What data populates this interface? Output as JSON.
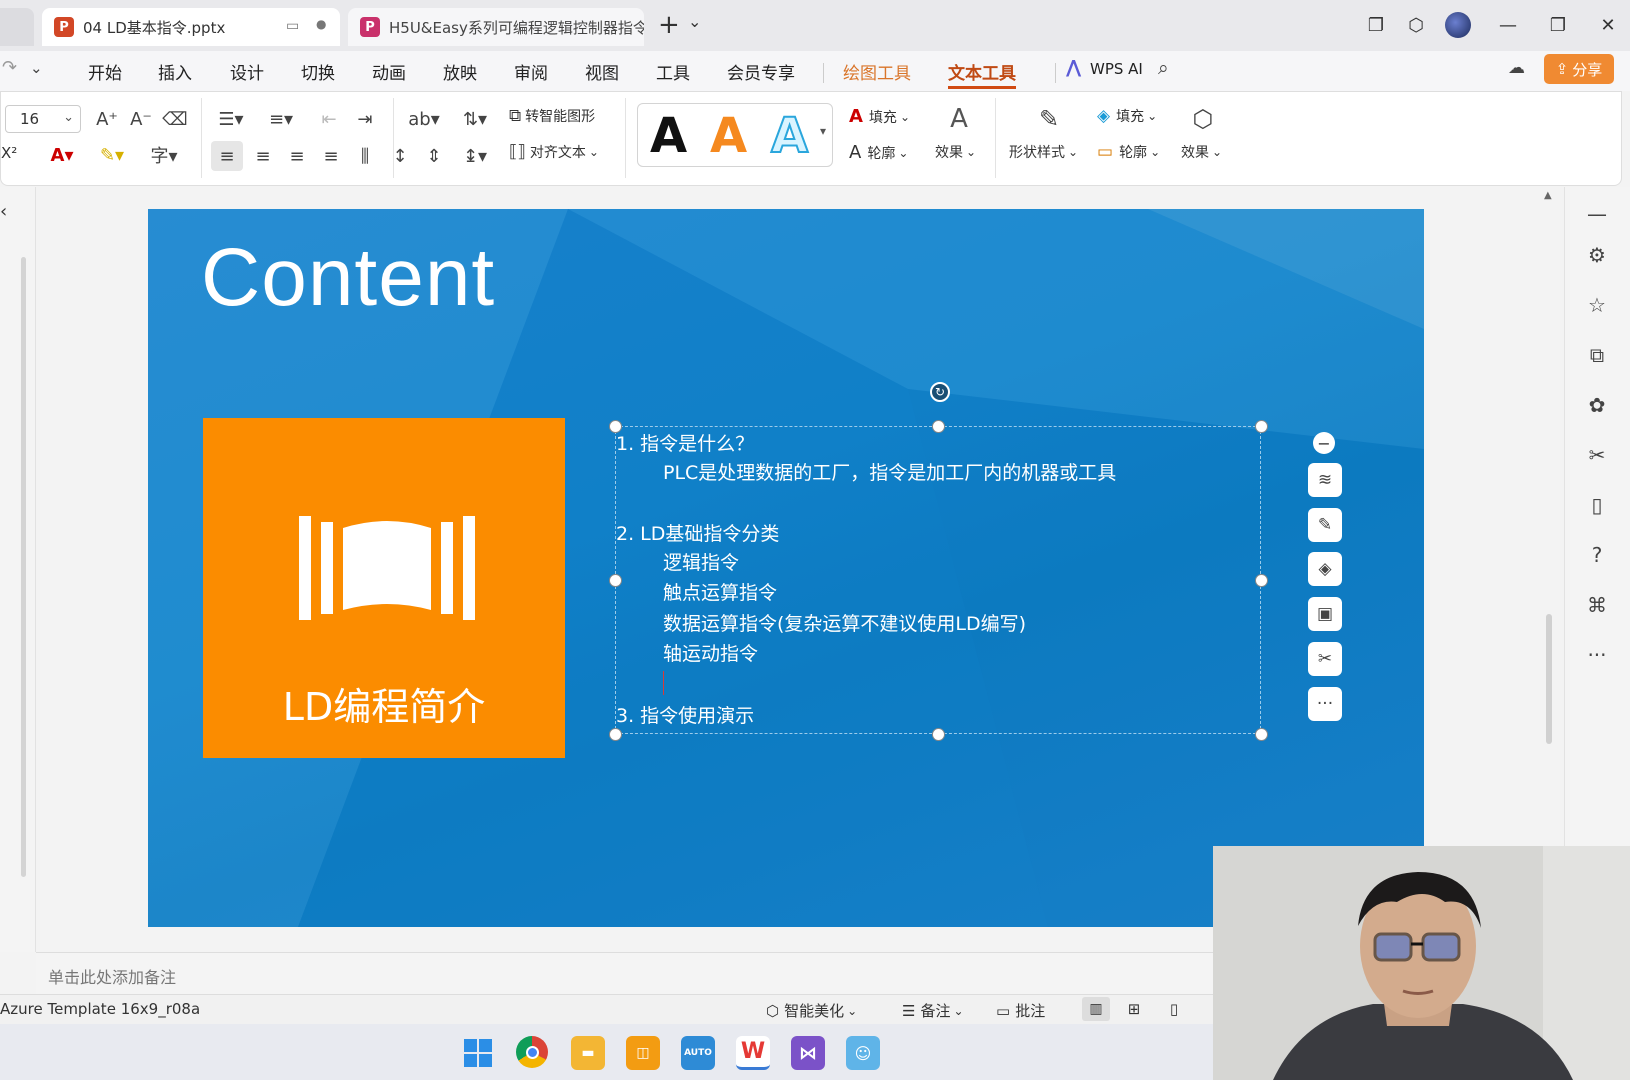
{
  "tabs": {
    "active_title": "04 LD基本指令.pptx",
    "second_title": "H5U&Easy系列可编程逻辑控制器指令",
    "new_tab": "+",
    "dropdown": "⌄"
  },
  "menu": {
    "items": [
      "开始",
      "插入",
      "设计",
      "切换",
      "动画",
      "放映",
      "审阅",
      "视图",
      "工具",
      "会员专享",
      "绘图工具",
      "文本工具"
    ],
    "wps_ai": "WPS AI",
    "share": "分享"
  },
  "ribbon": {
    "font_size": "16",
    "convert_smart": "转智能图形",
    "align_text": "对齐文本",
    "fill": "填充",
    "outline": "轮廓",
    "effect": "效果",
    "shape_style": "形状样式",
    "fill2": "填充",
    "outline2": "轮廓",
    "effect2": "效果",
    "style_letter": "A",
    "superscript": "X²"
  },
  "slide": {
    "title": "Content",
    "box_label": "LD编程简介",
    "lines": [
      "1. 指令是什么？",
      "PLC是处理数据的工厂，指令是加工厂内的机器或工具",
      "2. LD基础指令分类",
      "逻辑指令",
      "触点运算指令",
      "数据运算指令(复杂运算不建议使用LD编写)",
      "轴运动指令",
      "3. 指令使用演示"
    ]
  },
  "quick": {
    "more": "···"
  },
  "notes": {
    "placeholder": "单击此处添加备注"
  },
  "status": {
    "template": "Azure Template 16x9_r08a",
    "beautify": "智能美化",
    "notes_btn": "备注",
    "comment_btn": "批注"
  },
  "taskbar": {
    "auto_label": "AUTO"
  },
  "colors": {
    "slide_blue": "#1a85d0",
    "orange": "#fb8c00",
    "accent": "#d04a12",
    "share_bg": "#f08a32"
  }
}
